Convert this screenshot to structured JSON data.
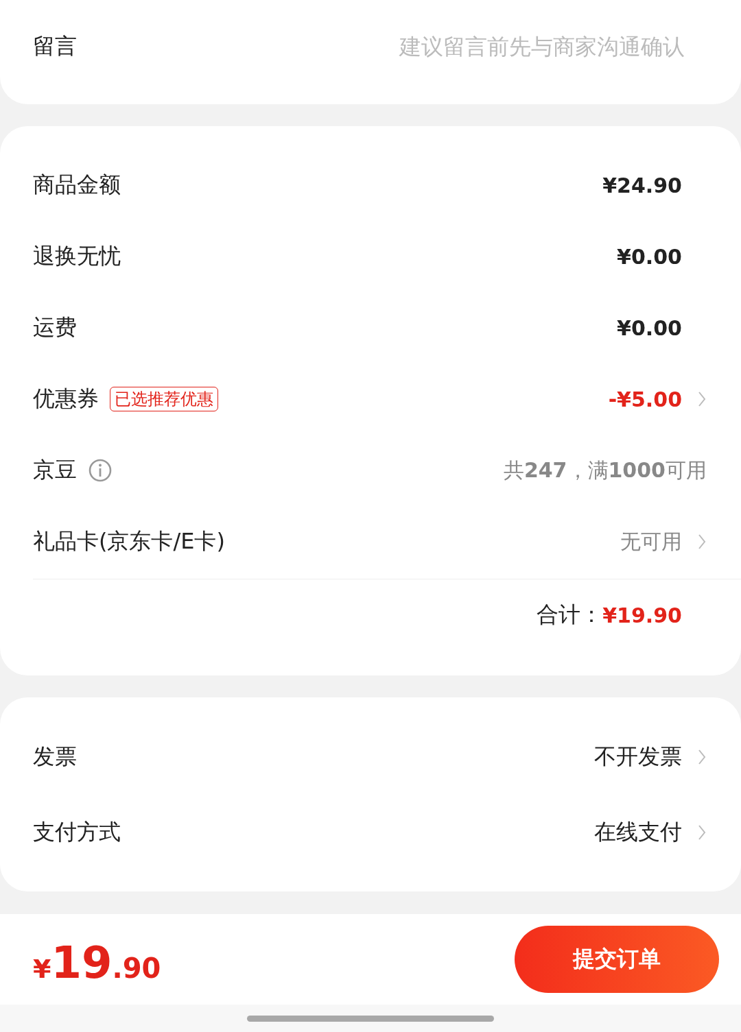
{
  "message": {
    "label": "留言",
    "placeholder": "建议留言前先与商家沟通确认"
  },
  "summary": {
    "rows": [
      {
        "label": "商品金额",
        "value": "¥24.90",
        "kind": "dark",
        "info": false,
        "chevron": false
      },
      {
        "label": "退换无忧",
        "value": "¥0.00",
        "kind": "dark",
        "info": false,
        "chevron": false
      },
      {
        "label": "运费",
        "value": "¥0.00",
        "kind": "dark",
        "info": false,
        "chevron": false
      },
      {
        "label": "优惠券",
        "tag": "已选推荐优惠",
        "value": "-¥5.00",
        "kind": "red",
        "info": false,
        "chevron": true
      },
      {
        "label": "京豆",
        "value": "共**247**，满**1000**可用",
        "kind": "gray",
        "info": true,
        "chevron": false
      },
      {
        "label": "礼品卡(京东卡/E卡)",
        "value": "无可用",
        "kind": "gray",
        "info": false,
        "chevron": true
      }
    ],
    "total": {
      "label": "合计：",
      "value": "¥19.90"
    }
  },
  "options": [
    {
      "label": "发票",
      "value": "不开发票",
      "chevron": true
    },
    {
      "label": "支付方式",
      "value": "在线支付",
      "chevron": true
    }
  ],
  "footer": {
    "currency": "¥",
    "integer": "19",
    "decimal": ".90",
    "submit": "提交订单"
  }
}
